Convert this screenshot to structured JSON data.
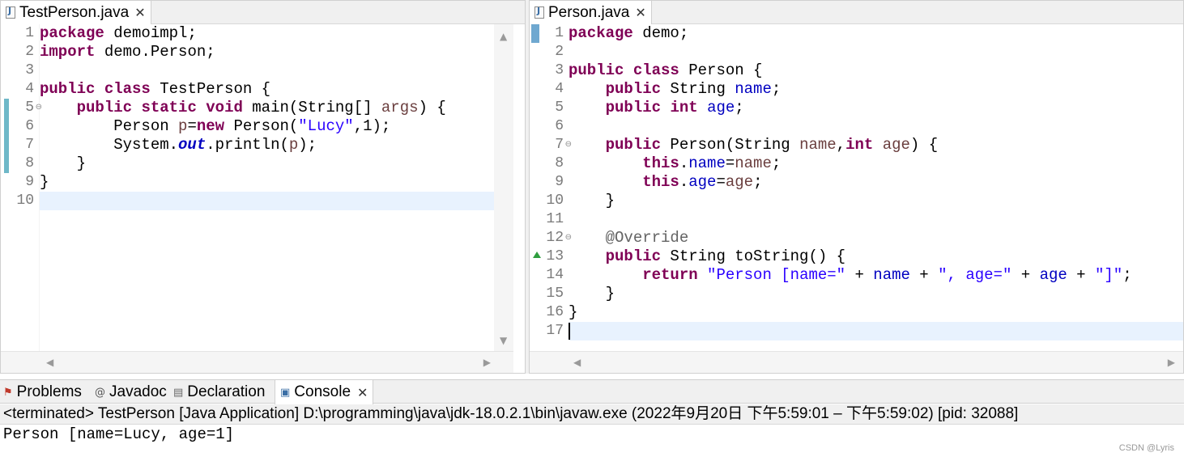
{
  "left_editor": {
    "tab_title": "TestPerson.java",
    "line_numbers": [
      "1",
      "2",
      "3",
      "4",
      "5",
      "6",
      "7",
      "8",
      "9",
      "10"
    ],
    "lines": [
      [
        {
          "t": "package",
          "c": "kw"
        },
        {
          "t": " demoimpl;"
        }
      ],
      [
        {
          "t": "import",
          "c": "kw"
        },
        {
          "t": " demo.Person;"
        }
      ],
      [],
      [
        {
          "t": "public",
          "c": "kw"
        },
        {
          "t": " "
        },
        {
          "t": "class",
          "c": "kw"
        },
        {
          "t": " TestPerson {"
        }
      ],
      [
        {
          "t": "    "
        },
        {
          "t": "public",
          "c": "kw"
        },
        {
          "t": " "
        },
        {
          "t": "static",
          "c": "kw"
        },
        {
          "t": " "
        },
        {
          "t": "void",
          "c": "kw"
        },
        {
          "t": " main(String[] "
        },
        {
          "t": "args",
          "c": "var"
        },
        {
          "t": ") {"
        }
      ],
      [
        {
          "t": "        Person "
        },
        {
          "t": "p",
          "c": "var"
        },
        {
          "t": "="
        },
        {
          "t": "new",
          "c": "kw"
        },
        {
          "t": " Person("
        },
        {
          "t": "\"Lucy\"",
          "c": "str"
        },
        {
          "t": ",1);"
        }
      ],
      [
        {
          "t": "        System."
        },
        {
          "t": "out",
          "c": "sfld"
        },
        {
          "t": ".println("
        },
        {
          "t": "p",
          "c": "var"
        },
        {
          "t": ");"
        }
      ],
      [
        {
          "t": "    }"
        }
      ],
      [
        {
          "t": "}"
        }
      ],
      []
    ]
  },
  "right_editor": {
    "tab_title": "Person.java",
    "line_numbers": [
      "1",
      "2",
      "3",
      "4",
      "5",
      "6",
      "7",
      "8",
      "9",
      "10",
      "11",
      "12",
      "13",
      "14",
      "15",
      "16",
      "17"
    ],
    "lines": [
      [
        {
          "t": "package",
          "c": "kw"
        },
        {
          "t": " demo;"
        }
      ],
      [],
      [
        {
          "t": "public",
          "c": "kw"
        },
        {
          "t": " "
        },
        {
          "t": "class",
          "c": "kw"
        },
        {
          "t": " Person {"
        }
      ],
      [
        {
          "t": "    "
        },
        {
          "t": "public",
          "c": "kw"
        },
        {
          "t": " String "
        },
        {
          "t": "name",
          "c": "fld"
        },
        {
          "t": ";"
        }
      ],
      [
        {
          "t": "    "
        },
        {
          "t": "public",
          "c": "kw"
        },
        {
          "t": " "
        },
        {
          "t": "int",
          "c": "kw"
        },
        {
          "t": " "
        },
        {
          "t": "age",
          "c": "fld"
        },
        {
          "t": ";"
        }
      ],
      [],
      [
        {
          "t": "    "
        },
        {
          "t": "public",
          "c": "kw"
        },
        {
          "t": " Person(String "
        },
        {
          "t": "name",
          "c": "var"
        },
        {
          "t": ","
        },
        {
          "t": "int",
          "c": "kw"
        },
        {
          "t": " "
        },
        {
          "t": "age",
          "c": "var"
        },
        {
          "t": ") {"
        }
      ],
      [
        {
          "t": "        "
        },
        {
          "t": "this",
          "c": "kw"
        },
        {
          "t": "."
        },
        {
          "t": "name",
          "c": "fld"
        },
        {
          "t": "="
        },
        {
          "t": "name",
          "c": "var"
        },
        {
          "t": ";"
        }
      ],
      [
        {
          "t": "        "
        },
        {
          "t": "this",
          "c": "kw"
        },
        {
          "t": "."
        },
        {
          "t": "age",
          "c": "fld"
        },
        {
          "t": "="
        },
        {
          "t": "age",
          "c": "var"
        },
        {
          "t": ";"
        }
      ],
      [
        {
          "t": "    }"
        }
      ],
      [],
      [
        {
          "t": "    "
        },
        {
          "t": "@Override",
          "c": "ann"
        }
      ],
      [
        {
          "t": "    "
        },
        {
          "t": "public",
          "c": "kw"
        },
        {
          "t": " String toString() {"
        }
      ],
      [
        {
          "t": "        "
        },
        {
          "t": "return",
          "c": "kw"
        },
        {
          "t": " "
        },
        {
          "t": "\"Person [name=\"",
          "c": "str"
        },
        {
          "t": " + "
        },
        {
          "t": "name",
          "c": "fld"
        },
        {
          "t": " + "
        },
        {
          "t": "\", age=\"",
          "c": "str"
        },
        {
          "t": " + "
        },
        {
          "t": "age",
          "c": "fld"
        },
        {
          "t": " + "
        },
        {
          "t": "\"]\"",
          "c": "str"
        },
        {
          "t": ";"
        }
      ],
      [
        {
          "t": "    }"
        }
      ],
      [
        {
          "t": "}"
        }
      ],
      []
    ]
  },
  "bottom_panel": {
    "tabs": {
      "problems": "Problems",
      "javadoc": "Javadoc",
      "declaration": "Declaration",
      "console": "Console"
    },
    "status": "<terminated> TestPerson [Java Application] D:\\programming\\java\\jdk-18.0.2.1\\bin\\javaw.exe  (2022年9月20日 下午5:59:01 – 下午5:59:02) [pid: 32088]",
    "output": "Person [name=Lucy, age=1]"
  },
  "watermark": "CSDN @Lyris"
}
